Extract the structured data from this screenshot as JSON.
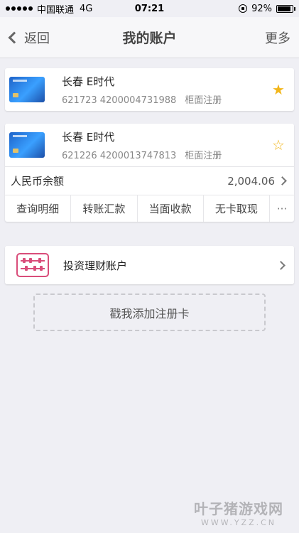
{
  "status_bar": {
    "carrier": "中国联通",
    "network": "4G",
    "time": "07:21",
    "battery": "92%",
    "battery_level": 0.92
  },
  "nav": {
    "back_label": "返回",
    "title": "我的账户",
    "more_label": "更多"
  },
  "cards": [
    {
      "name": "长春 E时代",
      "number": "621723 4200004731988",
      "registration": "柜面注册",
      "starred": true
    },
    {
      "name": "长春 E时代",
      "number": "621226 4200013747813",
      "registration": "柜面注册",
      "starred": false,
      "balance_label": "人民币余额",
      "balance_value": "2,004.06",
      "actions": [
        "查询明细",
        "转账汇款",
        "当面收款",
        "无卡取现",
        "···"
      ]
    }
  ],
  "invest": {
    "label": "投资理财账户"
  },
  "add_card": {
    "label": "戳我添加注册卡"
  },
  "watermark": {
    "main": "叶子猪游戏网",
    "sub": "WWW.YZZ.CN"
  },
  "colors": {
    "star": "#f2b61a",
    "accent_pink": "#d94d7a",
    "card_blue": "#1e63c9"
  }
}
